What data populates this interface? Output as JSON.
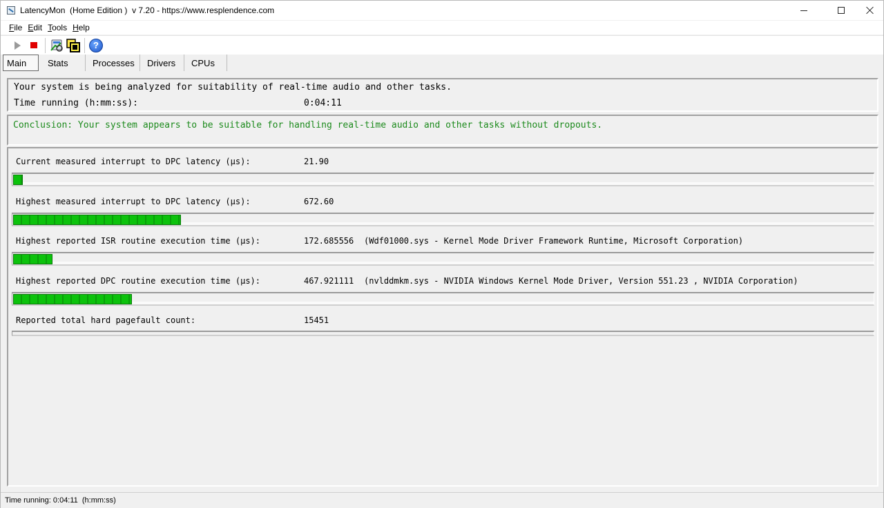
{
  "window": {
    "title": "LatencyMon  (Home Edition )  v 7.20 - https://www.resplendence.com"
  },
  "menu": [
    "File",
    "Edit",
    "Tools",
    "Help"
  ],
  "toolbar": {
    "icons": [
      "play-icon",
      "stop-icon",
      "driver-lookup-icon",
      "window-select-icon",
      "help-icon"
    ]
  },
  "tabs": [
    "Main",
    "Stats",
    "Processes",
    "Drivers",
    "CPUs"
  ],
  "selected_tab": "Main",
  "intro": {
    "analyzing": "Your system is being analyzed for suitability of real-time audio and other tasks.",
    "time_label": "Time running (h:mm:ss):",
    "time_value": "0:04:11"
  },
  "conclusion": {
    "text": "Conclusion: Your system appears to be suitable for handling real-time audio and other tasks without dropouts.",
    "color": "#1c8a1c"
  },
  "metrics": [
    {
      "label": "Current measured interrupt to DPC latency (µs):",
      "value": "21.90",
      "extra": "",
      "bar_fraction": 0.011
    },
    {
      "label": "Highest measured interrupt to DPC latency (µs):",
      "value": "672.60",
      "extra": "",
      "bar_fraction": 0.195
    },
    {
      "label": "Highest reported ISR routine execution time (µs):",
      "value": "172.685556",
      "extra": "(Wdf01000.sys - Kernel Mode Driver Framework Runtime, Microsoft Corporation)",
      "bar_fraction": 0.046
    },
    {
      "label": "Highest reported DPC routine execution time (µs):",
      "value": "467.921111",
      "extra": "(nvlddmkm.sys - NVIDIA Windows Kernel Mode Driver, Version 551.23 , NVIDIA Corporation)",
      "bar_fraction": 0.138
    },
    {
      "label": "Reported total hard pagefault count:",
      "value": "15451",
      "extra": "",
      "bar_fraction": 0
    }
  ],
  "bar_colors": {
    "fill": "#0cc20c",
    "segment_gap": "#0a9e0a"
  },
  "statusbar": {
    "text": "Time running: 0:04:11  (h:mm:ss)"
  }
}
